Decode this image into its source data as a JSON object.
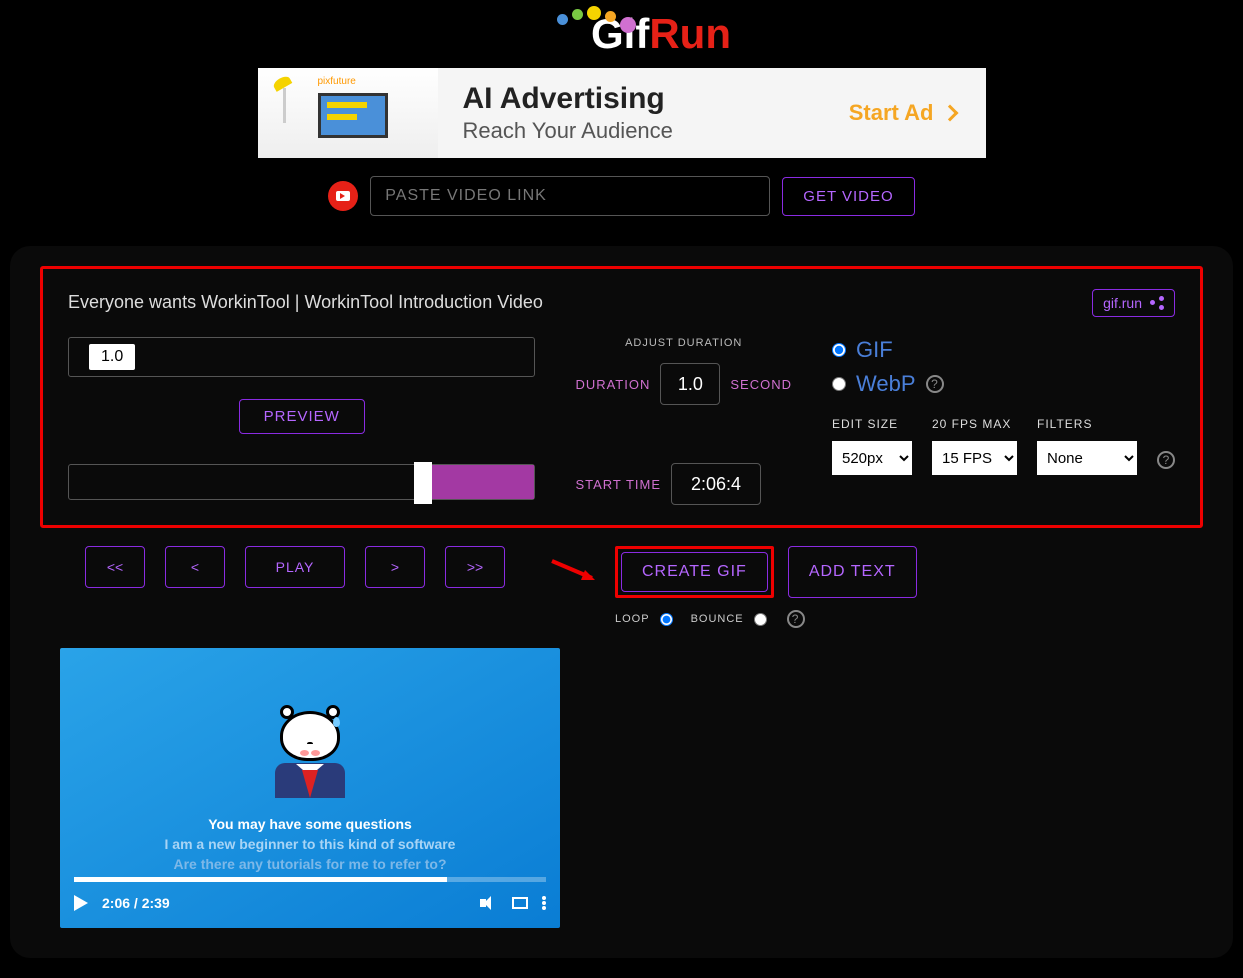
{
  "logo": {
    "gif": "Gif",
    "run": "Run"
  },
  "ad": {
    "pixlabel": "pixfuture",
    "headline": "AI Advertising",
    "sub": "Reach Your Audience",
    "cta": "Start Ad"
  },
  "input": {
    "placeholder": "PASTE VIDEO LINK",
    "getvideo": "GET VIDEO"
  },
  "video_title": "Everyone wants WorkinTool | WorkinTool Introduction Video",
  "share": "gif.run",
  "duration_value": "1.0",
  "preview": "PREVIEW",
  "adjust": "ADJUST  DURATION",
  "duration_label": "DURATION",
  "duration_input": "1.0",
  "second": "SECOND",
  "start_time_label": "START TIME",
  "start_time_value": "2:06:4",
  "format": {
    "gif": "GIF",
    "webp": "WebP"
  },
  "editsize_label": "EDIT SIZE",
  "fps_label": "20 FPS MAX",
  "filters_label": "FILTERS",
  "editsize_val": "520px",
  "fps_val": "15 FPS",
  "filters_val": "None",
  "nav": {
    "rr": "<<",
    "r": "<",
    "play": "PLAY",
    "f": ">",
    "ff": ">>"
  },
  "create": "CREATE GIF",
  "addtext": "ADD TEXT",
  "loop": "LOOP",
  "bounce": "BOUNCE",
  "captions": {
    "l1": "You may have some questions",
    "l2": "I am a new beginner to this kind of software",
    "l3": "Are there any tutorials for me to refer to?"
  },
  "vtime": "2:06 / 2:39"
}
